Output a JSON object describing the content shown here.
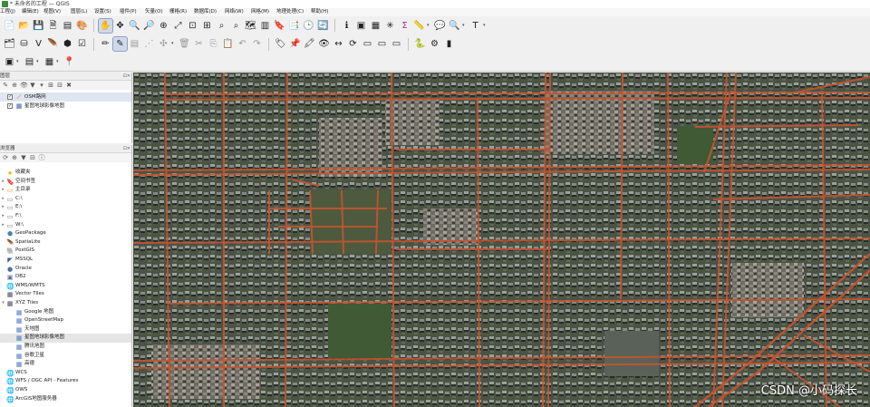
{
  "window": {
    "title": "* 未命名的工程 — QGIS"
  },
  "menu": [
    "工程(J)",
    "编辑(E)",
    "视图(V)",
    "图层(L)",
    "设置(S)",
    "插件(P)",
    "矢量(O)",
    "栅格(R)",
    "数据库(D)",
    "网络(W)",
    "网格(M)",
    "地理处理(C)",
    "帮助(H)"
  ],
  "layers_panel": {
    "title": "图层",
    "items": [
      {
        "label": "OSM路网",
        "checked": true,
        "icon": "line-layer-icon"
      },
      {
        "label": "星图地球影像地图",
        "checked": true,
        "icon": "raster-layer-icon"
      }
    ]
  },
  "browser_panel": {
    "title": "浏览器",
    "items": [
      {
        "label": "收藏夹",
        "icon": "star-icon",
        "indent": 0,
        "arrow": "",
        "selected": false
      },
      {
        "label": "空间书签",
        "icon": "bookmark-icon",
        "indent": 0,
        "arrow": "▸",
        "selected": false
      },
      {
        "label": "主目录",
        "icon": "folder-icon",
        "indent": 0,
        "arrow": "▸",
        "selected": false
      },
      {
        "label": "C:\\",
        "icon": "drive-icon",
        "indent": 0,
        "arrow": "▸",
        "selected": false
      },
      {
        "label": "E:\\",
        "icon": "drive-icon",
        "indent": 0,
        "arrow": "▸",
        "selected": false
      },
      {
        "label": "F:\\",
        "icon": "drive-icon",
        "indent": 0,
        "arrow": "▸",
        "selected": false
      },
      {
        "label": "W:\\",
        "icon": "drive-icon",
        "indent": 0,
        "arrow": "▸",
        "selected": false
      },
      {
        "label": "GeoPackage",
        "icon": "geopackage-icon",
        "indent": 0,
        "arrow": "",
        "selected": false
      },
      {
        "label": "SpatiaLite",
        "icon": "spatialite-icon",
        "indent": 0,
        "arrow": "",
        "selected": false
      },
      {
        "label": "PostGIS",
        "icon": "postgis-icon",
        "indent": 0,
        "arrow": "",
        "selected": false
      },
      {
        "label": "MSSQL",
        "icon": "mssql-icon",
        "indent": 0,
        "arrow": "",
        "selected": false
      },
      {
        "label": "Oracle",
        "icon": "oracle-icon",
        "indent": 0,
        "arrow": "",
        "selected": false
      },
      {
        "label": "DB2",
        "icon": "db2-icon",
        "indent": 0,
        "arrow": "",
        "selected": false
      },
      {
        "label": "WMS/WMTS",
        "icon": "wms-icon",
        "indent": 0,
        "arrow": "",
        "selected": false
      },
      {
        "label": "Vector Tiles",
        "icon": "vector-tiles-icon",
        "indent": 0,
        "arrow": "",
        "selected": false
      },
      {
        "label": "XYZ Tiles",
        "icon": "xyz-tiles-icon",
        "indent": 0,
        "arrow": "▾",
        "selected": false
      },
      {
        "label": "Google 地图",
        "icon": "grid-icon",
        "indent": 1,
        "arrow": "",
        "selected": false
      },
      {
        "label": "OpenStreetMap",
        "icon": "grid-icon",
        "indent": 1,
        "arrow": "",
        "selected": false
      },
      {
        "label": "天地图",
        "icon": "grid-icon",
        "indent": 1,
        "arrow": "",
        "selected": false
      },
      {
        "label": "星图地球影像地图",
        "icon": "grid-icon",
        "indent": 1,
        "arrow": "",
        "selected": true
      },
      {
        "label": "腾讯地图",
        "icon": "grid-icon",
        "indent": 1,
        "arrow": "",
        "selected": false
      },
      {
        "label": "谷歌卫星",
        "icon": "grid-icon",
        "indent": 1,
        "arrow": "",
        "selected": false
      },
      {
        "label": "高德",
        "icon": "grid-icon",
        "indent": 1,
        "arrow": "",
        "selected": false
      },
      {
        "label": "WCS",
        "icon": "wcs-icon",
        "indent": 0,
        "arrow": "",
        "selected": false
      },
      {
        "label": "WFS / OGC API - Features",
        "icon": "wfs-icon",
        "indent": 0,
        "arrow": "",
        "selected": false
      },
      {
        "label": "OWS",
        "icon": "ows-icon",
        "indent": 0,
        "arrow": "",
        "selected": false
      },
      {
        "label": "ArcGIS地图服务器",
        "icon": "arcgis-icon",
        "indent": 0,
        "arrow": "",
        "selected": false
      }
    ]
  },
  "map": {
    "watermark": "CSDN @小码探长"
  },
  "colors": {
    "road": "#c6532f",
    "imagery": "#4f5748"
  }
}
